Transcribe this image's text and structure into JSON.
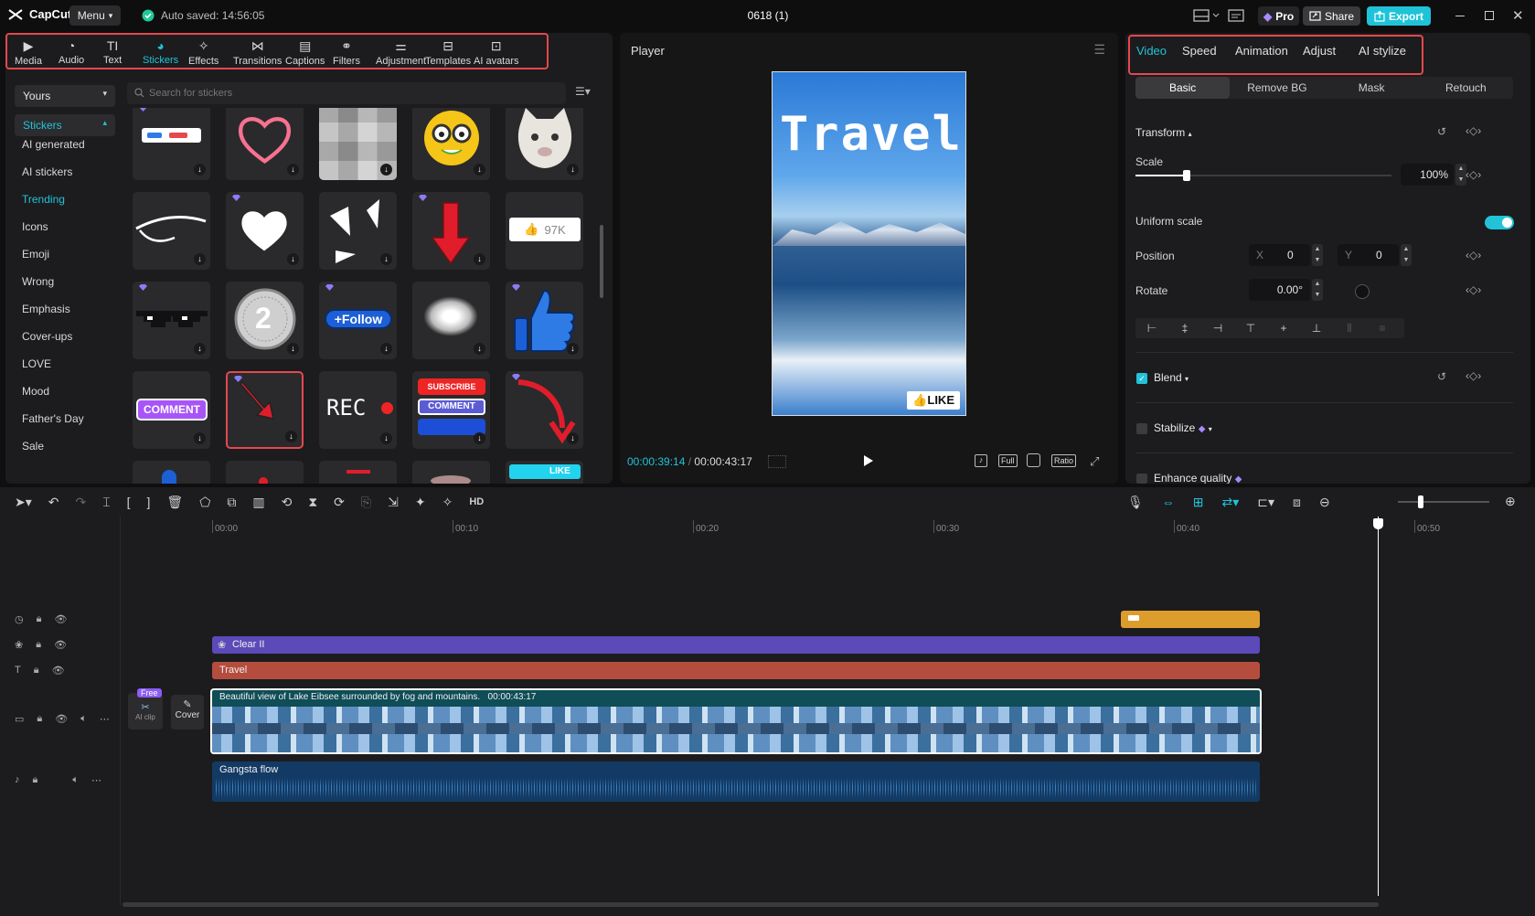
{
  "app": {
    "name": "CapCut",
    "menu_label": "Menu",
    "autosave": "Auto saved: 14:56:05",
    "project_title": "0618 (1)"
  },
  "header_buttons": {
    "pro": "Pro",
    "share": "Share",
    "export": "Export"
  },
  "colors": {
    "accent": "#22c3d8",
    "highlight": "#e5484d",
    "background": "#1c1c1e"
  },
  "tools": [
    {
      "label": "Media",
      "icon": "media-icon"
    },
    {
      "label": "Audio",
      "icon": "audio-icon"
    },
    {
      "label": "Text",
      "icon": "text-icon"
    },
    {
      "label": "Stickers",
      "icon": "stickers-icon"
    },
    {
      "label": "Effects",
      "icon": "effects-icon"
    },
    {
      "label": "Transitions",
      "icon": "transitions-icon"
    },
    {
      "label": "Captions",
      "icon": "captions-icon"
    },
    {
      "label": "Filters",
      "icon": "filters-icon"
    },
    {
      "label": "Adjustment",
      "icon": "adjustment-icon"
    },
    {
      "label": "Templates",
      "icon": "templates-icon"
    },
    {
      "label": "AI avatars",
      "icon": "ai-avatars-icon"
    }
  ],
  "sidebar": {
    "dropdown": "Yours",
    "section": "Stickers",
    "items": [
      "AI generated",
      "AI stickers",
      "Trending",
      "Icons",
      "Emoji",
      "Wrong",
      "Emphasis",
      "Cover-ups",
      "LOVE",
      "Mood",
      "Father's Day",
      "Sale"
    ],
    "selected": "Trending"
  },
  "search": {
    "placeholder": "Search for stickers"
  },
  "stickers": {
    "like_count": "97K",
    "follow": "+Follow",
    "comment": "COMMENT",
    "rec": "REC",
    "subscribe": "SUBSCRIBE",
    "comment2": "COMMENT",
    "coin_number": "2",
    "like_small": "LIKE"
  },
  "player": {
    "title": "Player",
    "preview_text": "Travel",
    "sticker_text": "LIKE",
    "current_time": "00:00:39:14",
    "total_time": "00:00:43:17",
    "full_label": "Full",
    "ratio_label": "Ratio"
  },
  "right_panel": {
    "tabs": [
      "Video",
      "Speed",
      "Animation",
      "Adjust",
      "AI stylize"
    ],
    "subtabs": [
      "Basic",
      "Remove BG",
      "Mask",
      "Retouch"
    ],
    "transform": "Transform",
    "scale_label": "Scale",
    "scale_value": "100%",
    "scale_fraction": 0.2,
    "uniform_scale": "Uniform scale",
    "uniform_on": true,
    "position_label": "Position",
    "pos_x_label": "X",
    "pos_x": "0",
    "pos_y_label": "Y",
    "pos_y": "0",
    "rotate_label": "Rotate",
    "rotate_value": "0.00°",
    "blend": "Blend",
    "stabilize": "Stabilize",
    "enhance": "Enhance quality"
  },
  "timeline": {
    "hd": "HD",
    "ruler": [
      "00:00",
      "00:10",
      "00:20",
      "00:30",
      "00:40",
      "00:50"
    ],
    "playhead_fraction": 0.904,
    "tracks": {
      "effect": "Clear II",
      "text": "Travel",
      "video_title": "Beautiful view of Lake Eibsee surrounded by fog and mountains.",
      "video_duration": "00:00:43:17",
      "audio": "Gangsta flow"
    },
    "free_badge": "Free",
    "ai_clip": "AI clip",
    "cover": "Cover"
  }
}
